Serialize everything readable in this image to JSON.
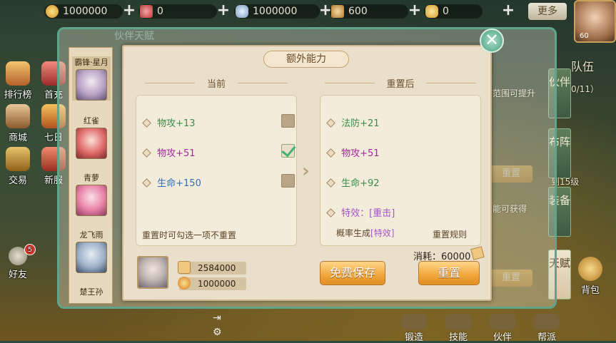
{
  "top_bar": {
    "resources": [
      {
        "icon": "gold-coin-icon",
        "value": "1000000"
      },
      {
        "icon": "ticket-icon",
        "value": "0"
      },
      {
        "icon": "silver-ingot-icon",
        "value": "1000000"
      },
      {
        "icon": "stamina-icon",
        "value": "600"
      },
      {
        "icon": "gold-ingot-icon",
        "value": "0"
      }
    ],
    "more_label": "更多",
    "player_level": "60"
  },
  "left_menu": [
    {
      "label": "排行榜"
    },
    {
      "label": "首充"
    },
    {
      "label": "商城"
    },
    {
      "label": "七日"
    },
    {
      "label": "交易"
    },
    {
      "label": "新服"
    },
    {
      "label": "好友",
      "badge": "5"
    }
  ],
  "background_panel": {
    "title": "伙伴天赋",
    "heroes": [
      {
        "name": "霸锋·星月"
      },
      {
        "name": "红雀"
      },
      {
        "name": "青萝"
      },
      {
        "name": "龙飞雨"
      },
      {
        "name": "楚王孙"
      }
    ],
    "side_tabs": [
      "伙伴",
      "布阵",
      "装备",
      "天赋"
    ],
    "team_label": "队伍",
    "team_count": "0/11）",
    "hint_text": "范围可提升",
    "level_text": "到15级",
    "obtain_text": "能可获得",
    "bg_reset": "重置"
  },
  "modal": {
    "title": "额外能力",
    "current_header": "当前",
    "after_header": "重置后",
    "current_attrs": [
      {
        "label": "物攻+13",
        "color": "#3c8c4a",
        "checked": false
      },
      {
        "label": "物攻+51",
        "color": "#a4289c",
        "checked": true
      },
      {
        "label": "生命+150",
        "color": "#2f6fb3",
        "checked": false
      }
    ],
    "after_attrs": [
      {
        "label": "法防+21",
        "color": "#3c8c4a"
      },
      {
        "label": "物攻+51",
        "color": "#a4289c"
      },
      {
        "label": "生命+92",
        "color": "#3c8c4a"
      },
      {
        "label": "特效：[重击]",
        "color": "#a455c9"
      }
    ],
    "lock_hint": "重置时可勾选一项不重置",
    "prob_prefix": "概率生成",
    "prob_effect": "[特效]",
    "rules_label": "重置规则",
    "cost_label": "消耗：60000",
    "currency_1": "2584000",
    "currency_2": "1000000",
    "free_save_label": "免费保存",
    "reset_label": "重置"
  },
  "bottom_nav": [
    "锻造",
    "技能",
    "伙伴",
    "帮派"
  ],
  "bag_label": "背包",
  "colors": {
    "accent_gold": "#f0a63a",
    "frame_teal": "#5fa58c",
    "panel_bg": "#eadfca"
  }
}
